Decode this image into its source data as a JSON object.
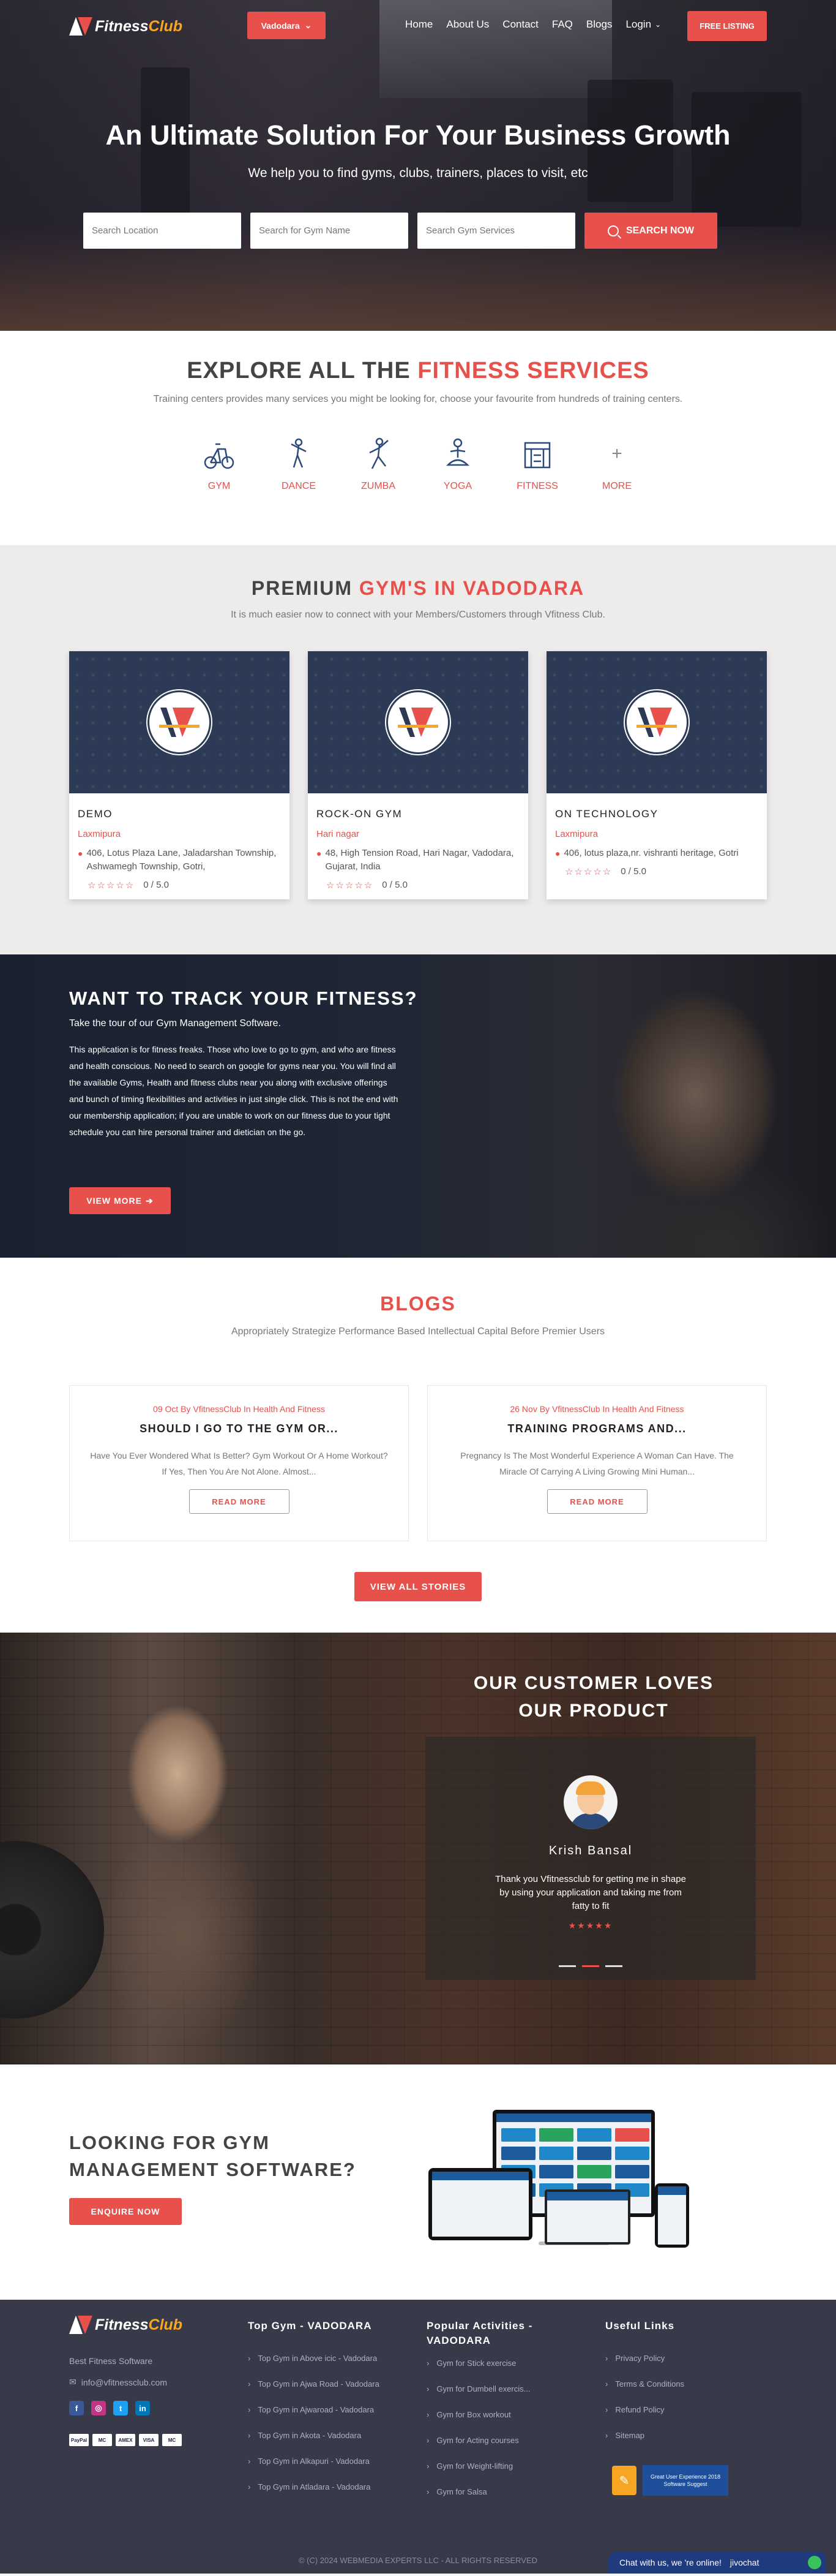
{
  "nav": {
    "logo_main": "Fitness",
    "logo_accent": "Club",
    "city": "Vadodara",
    "menu": [
      "Home",
      "About Us",
      "Contact",
      "FAQ",
      "Blogs",
      "Login"
    ],
    "free_listing": "FREE LISTING"
  },
  "hero": {
    "title": "An Ultimate Solution For Your Business Growth",
    "subtitle": "We help you to find gyms, clubs, trainers, places to visit, etc",
    "search_location_ph": "Search Location",
    "search_gym_ph": "Search for Gym Name",
    "search_services_ph": "Search Gym Services",
    "search_btn": "SEARCH NOW"
  },
  "services": {
    "title_plain": "EXPLORE ALL THE",
    "title_accent": "FITNESS SERVICES",
    "subtitle": "Training centers provides many services you might be looking for, choose your favourite from hundreds of training centers.",
    "items": [
      {
        "label": "GYM",
        "icon": "bike-icon"
      },
      {
        "label": "DANCE",
        "icon": "dance-icon"
      },
      {
        "label": "ZUMBA",
        "icon": "zumba-icon"
      },
      {
        "label": "YOGA",
        "icon": "yoga-icon"
      },
      {
        "label": "FITNESS",
        "icon": "fitness-icon"
      },
      {
        "label": "MORE",
        "icon": "plus-icon"
      }
    ]
  },
  "premium": {
    "title_plain": "PREMIUM",
    "title_accent": "GYM'S IN VADODARA",
    "subtitle": "It is much easier now to connect with your Members/Customers through Vfitness Club.",
    "cards": [
      {
        "name": "DEMO",
        "area": "Laxmipura",
        "address": "406, Lotus Plaza Lane, Jaladarshan Township, Ashwamegh Township, Gotri,",
        "rating": "0 / 5.0"
      },
      {
        "name": "ROCK-ON GYM",
        "area": "Hari nagar",
        "address": "48, High Tension Road, Hari Nagar, Vadodara, Gujarat, India",
        "rating": "0 / 5.0"
      },
      {
        "name": "ON TECHNOLOGY",
        "area": "Laxmipura",
        "address": "406, lotus plaza,nr. vishranti heritage, Gotri",
        "rating": "0 / 5.0"
      }
    ]
  },
  "track": {
    "title": "WANT TO TRACK YOUR FITNESS?",
    "subtitle": "Take the tour of our Gym Management Software.",
    "text": "This application is for fitness freaks. Those who love to go to gym, and who are fitness and health conscious. No need to search on google for gyms near you. You will find all the available Gyms, Health and fitness clubs near you along with exclusive offerings and bunch of timing flexibilities and activities in just single click. This is not the end with our membership application; if you are unable to work on our fitness due to your tight schedule you can hire personal trainer and dietician on the go.",
    "button": "VIEW MORE"
  },
  "blogs": {
    "title": "BLOGS",
    "subtitle": "Appropriately Strategize Performance Based Intellectual Capital Before Premier Users",
    "items": [
      {
        "meta": "09 Oct By VfitnessClub In Health And Fitness",
        "title": "SHOULD I GO TO THE GYM OR...",
        "excerpt": "Have You Ever Wondered What Is Better? Gym Workout Or A Home Workout? If Yes, Then You Are Not Alone. Almost...",
        "button": "READ MORE"
      },
      {
        "meta": "26 Nov By VfitnessClub In Health And Fitness",
        "title": "TRAINING PROGRAMS AND...",
        "excerpt": "Pregnancy Is The Most Wonderful Experience A Woman Can Have. The Miracle Of Carrying A Living Growing Mini Human...",
        "button": "READ MORE"
      }
    ],
    "view_all": "VIEW ALL STORIES"
  },
  "testimonial": {
    "title": "OUR CUSTOMER LOVES OUR PRODUCT",
    "name": "Krish Bansal",
    "text": "Thank you Vfitnessclub for getting me in shape by using your application and taking me from fatty to fit",
    "stars": "★★★★★",
    "active_slide": 1
  },
  "software": {
    "title": "LOOKING FOR GYM MANAGEMENT SOFTWARE?",
    "button": "ENQUIRE NOW"
  },
  "footer": {
    "tagline": "Best Fitness Software",
    "email": "info@vfitnessclub.com",
    "top_gym_title": "Top Gym - VADODARA",
    "top_gyms": [
      "Top Gym in Above icic - Vadodara",
      "Top Gym in Ajwa Road - Vadodara",
      "Top Gym in Ajwaroad - Vadodara",
      "Top Gym in Akota - Vadodara",
      "Top Gym in Alkapuri - Vadodara",
      "Top Gym in Atladara - Vadodara"
    ],
    "activities_title": "Popular Activities - VADODARA",
    "activities": [
      "Gym for Stick exercise",
      "Gym for Dumbell exercis...",
      "Gym for Box workout",
      "Gym for Acting courses",
      "Gym for Weight-lifting",
      "Gym for Salsa"
    ],
    "links_title": "Useful Links",
    "links": [
      "Privacy Policy",
      "Terms & Conditions",
      "Refund Policy",
      "Sitemap"
    ],
    "payments": [
      "PayPal",
      "MC",
      "AMEX",
      "VISA",
      "MC"
    ],
    "award_text": "Great User Experience 2018 Software Suggest",
    "copyright": "© (C) 2024 WEBMEDIA EXPERTS LLC - ALL RIGHTS RESERVED",
    "chat": "Chat with us, we 're online!",
    "chat_brand": "jivochat"
  },
  "colors": {
    "accent": "#e8504b",
    "footer_bg": "#383a49",
    "card_bg": "#2c3a55"
  }
}
